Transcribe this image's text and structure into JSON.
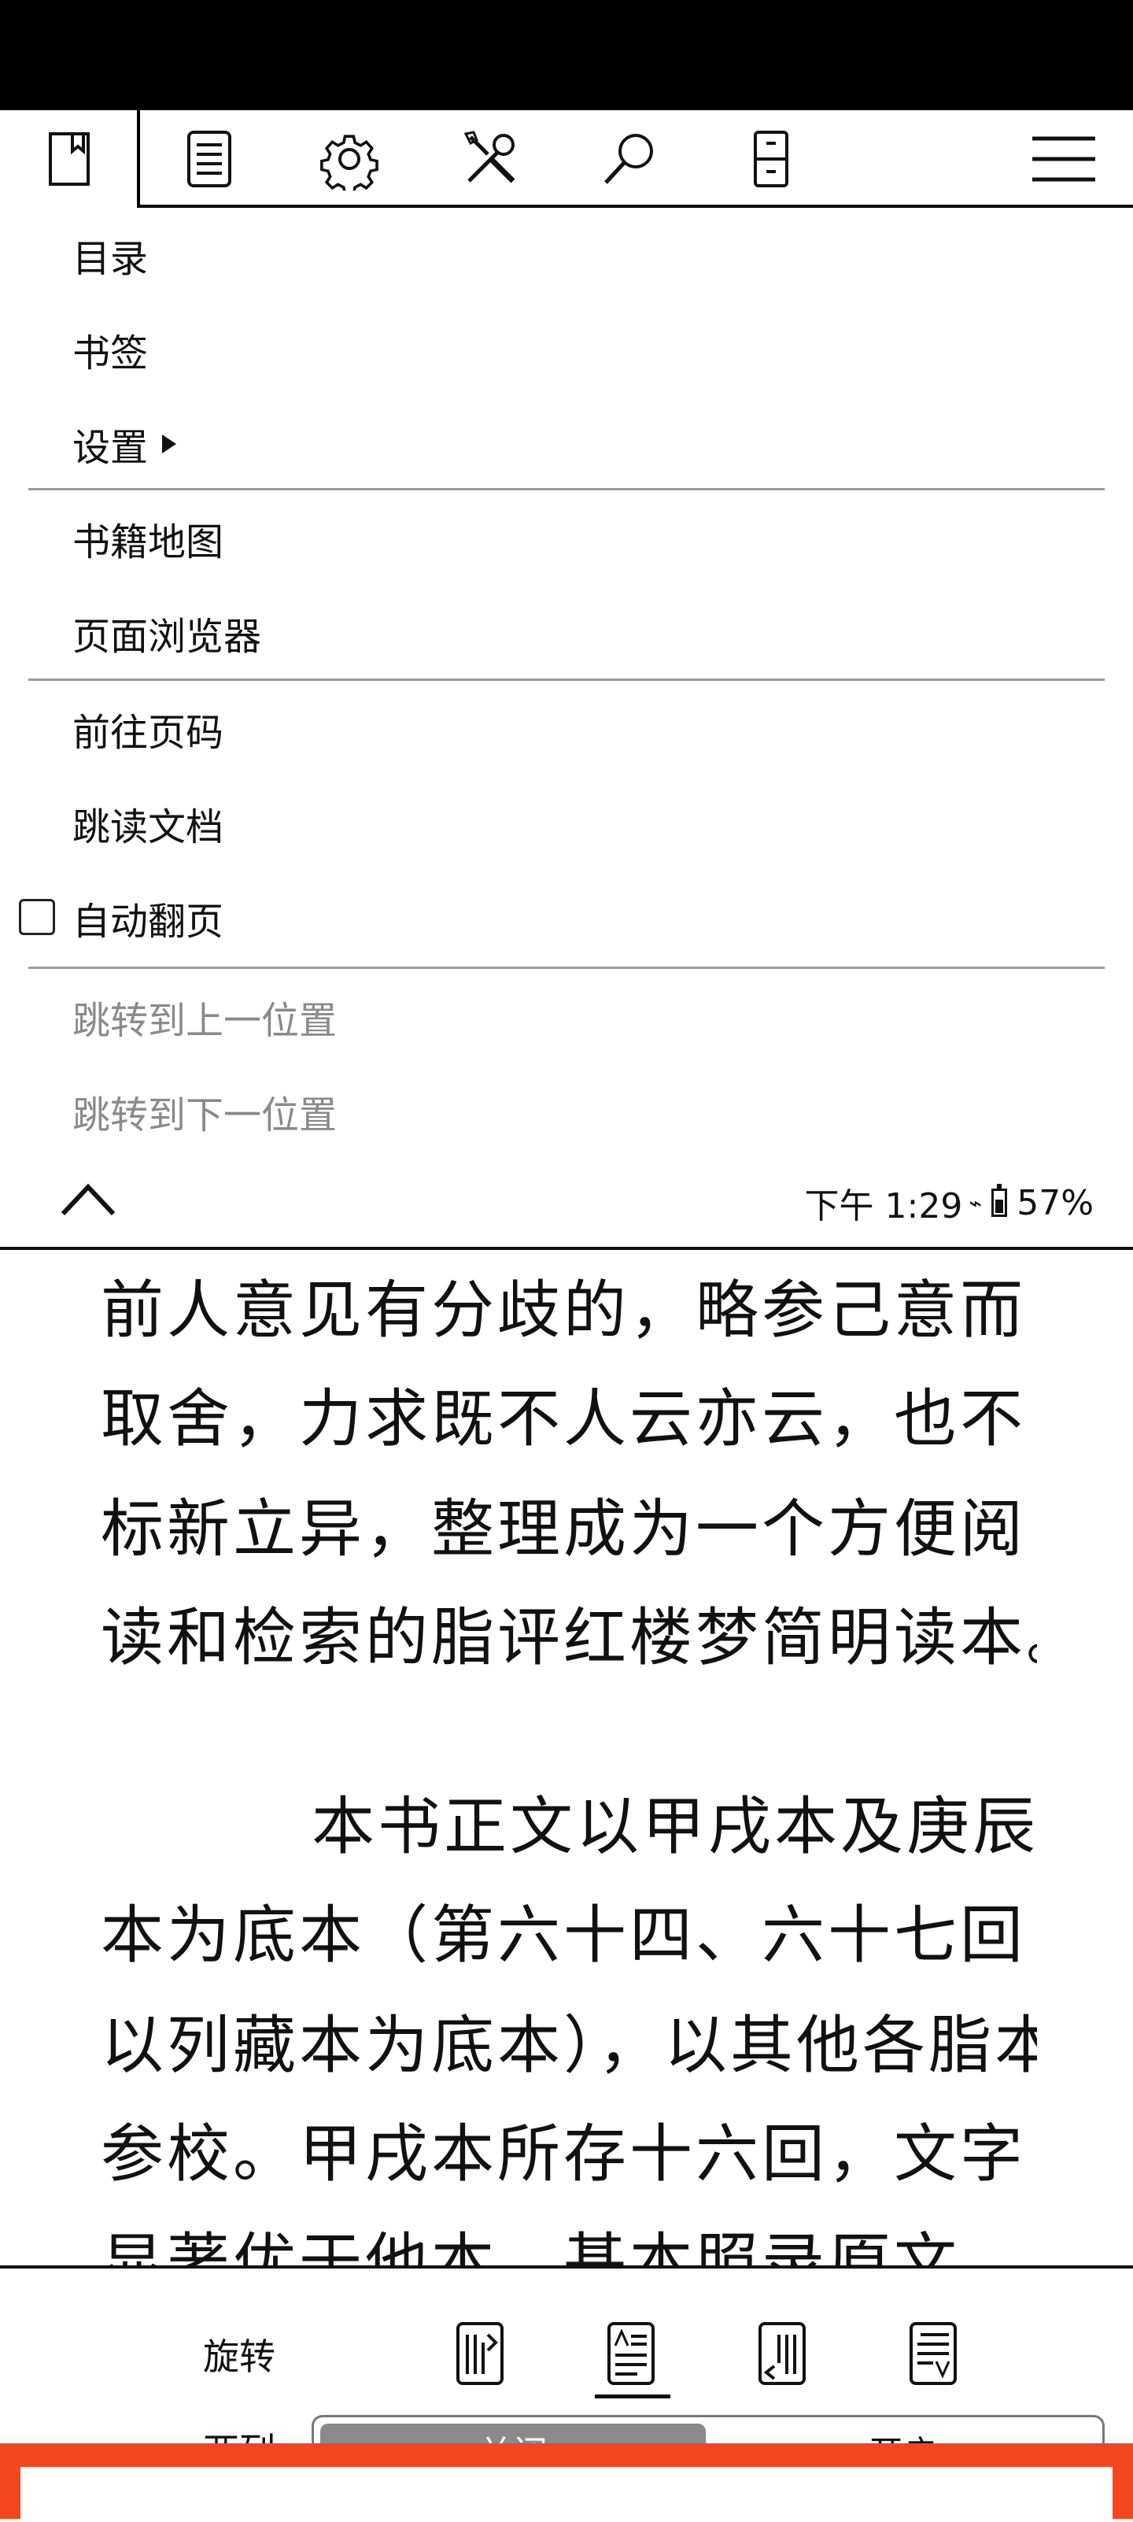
{
  "toolbar": {
    "tabs": [
      {
        "name": "book-icon"
      },
      {
        "name": "document-list-icon"
      },
      {
        "name": "gear-icon"
      },
      {
        "name": "tools-icon"
      },
      {
        "name": "search-icon"
      },
      {
        "name": "device-icon"
      },
      {
        "name": "hamburger-menu-icon"
      }
    ]
  },
  "menu": {
    "items": [
      {
        "label": "目录"
      },
      {
        "label": "书签"
      },
      {
        "label": "设置"
      },
      {
        "label": "书籍地图"
      },
      {
        "label": "页面浏览器"
      },
      {
        "label": "前往页码"
      },
      {
        "label": "跳读文档"
      },
      {
        "label": "自动翻页",
        "checked": false
      },
      {
        "label": "跳转到上一位置",
        "disabled": true
      },
      {
        "label": "跳转到下一位置",
        "disabled": true
      }
    ]
  },
  "status": {
    "time": "下午 1:29",
    "battery": "57%",
    "battery_level": 0.57
  },
  "reading": {
    "lines": [
      "前人意见有分歧的，略参己意而",
      "取舍，力求既不人云亦云，也不",
      "标新立异，整理成为一个方便阅",
      "读和检索的脂评红楼梦简明读本。",
      "本书正文以甲戌本及庚辰",
      "本为底本（第六十四、六十七回",
      "以列藏本为底本），以其他各脂本",
      "参校。甲戌本所存十六回，文字",
      "显著优于他本，基本照录原文，"
    ]
  },
  "bottom": {
    "rotate_label": "旋转",
    "toggle_label": "两列",
    "toggle_on": "关闭",
    "toggle_off": "开启"
  }
}
